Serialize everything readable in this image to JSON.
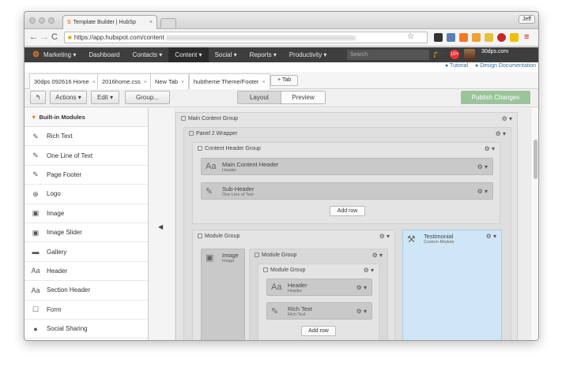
{
  "browser": {
    "tab_title": "Template Builder | HubSp",
    "tab_favicon": "S",
    "tab_close": "×",
    "user": "Jeff",
    "url_text": "https://app.hubspot.com/content"
  },
  "hub_nav": {
    "logo": "⚙",
    "items": [
      "Marketing ▾",
      "Dashboard",
      "Contacts ▾",
      "Content ▾",
      "Social ▾",
      "Reports ▾",
      "Productivity ▾"
    ],
    "search_placeholder": "Search",
    "notification_count": "10+",
    "portal_label": "30dps.com"
  },
  "help_links": {
    "tutorial": "Tutorial",
    "design_docs": "Design Documentation"
  },
  "file_tabs": [
    {
      "label": "30dps 092616 Home"
    },
    {
      "label": "2016home.css"
    },
    {
      "label": "New Tab"
    },
    {
      "label": "hubtheme Theme/Footer"
    }
  ],
  "tab_close": "×",
  "add_tab_label": "+ Tab",
  "toolbar": {
    "back": "↰",
    "actions": "Actions ▾",
    "edit": "Edit ▾",
    "group": "Group...",
    "layout": "Layout",
    "preview": "Preview",
    "publish": "Publish Changes"
  },
  "sidebar": {
    "title": "Built-in Modules",
    "collapse_arrow": "◀",
    "items": [
      {
        "label": "Rich Text",
        "icon": "✎"
      },
      {
        "label": "One Line of Text",
        "icon": "✎"
      },
      {
        "label": "Page Footer",
        "icon": "✎"
      },
      {
        "label": "Logo",
        "icon": "⊕"
      },
      {
        "label": "Image",
        "icon": "▣"
      },
      {
        "label": "Image Slider",
        "icon": "▣"
      },
      {
        "label": "Gallery",
        "icon": "▬"
      },
      {
        "label": "Header",
        "icon": "Aa"
      },
      {
        "label": "Section Header",
        "icon": "Aa"
      },
      {
        "label": "Form",
        "icon": "☐"
      },
      {
        "label": "Social Sharing",
        "icon": "●"
      }
    ]
  },
  "canvas": {
    "gear": "⚙ ▾",
    "main_group": "Main Content Group",
    "panel_wrapper": "Panel 2 Wrapper",
    "content_header_group": "Content Header Group",
    "main_header": {
      "title": "Main Content Header",
      "subtitle": "Header",
      "icon": "Aa"
    },
    "sub_header": {
      "title": "Sub-Header",
      "subtitle": "One Line of Text",
      "icon": "✎"
    },
    "add_row": "Add row",
    "module_group": "Module Group",
    "image_mod": {
      "title": "Image",
      "subtitle": "Image",
      "icon": "▣"
    },
    "module_group_2": "Module Group",
    "module_group_3": "Module Group",
    "header_mod": {
      "title": "Header",
      "subtitle": "Header",
      "icon": "Aa"
    },
    "rich_text_mod": {
      "title": "Rich Text",
      "subtitle": "Rich Text",
      "icon": "✎"
    },
    "add_row_2": "Add row",
    "testimonial": {
      "title": "Testimonial",
      "subtitle": "Custom Module",
      "icon": "⚒"
    }
  }
}
